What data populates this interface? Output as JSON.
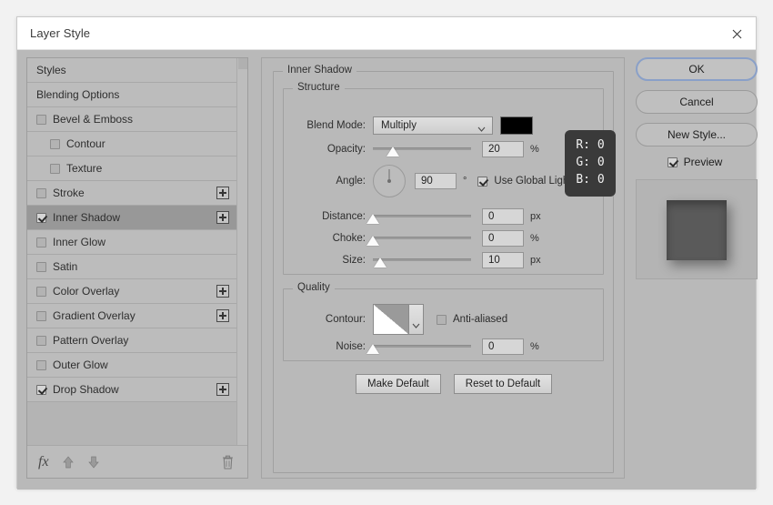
{
  "window": {
    "title": "Layer Style",
    "close_icon": "close-icon"
  },
  "styles_panel": {
    "items": [
      {
        "label": "Styles",
        "checkbox": false,
        "checked": false,
        "indent": false,
        "plus": false,
        "selected": false
      },
      {
        "label": "Blending Options",
        "checkbox": false,
        "checked": false,
        "indent": false,
        "plus": false,
        "selected": false
      },
      {
        "label": "Bevel & Emboss",
        "checkbox": true,
        "checked": false,
        "indent": false,
        "plus": false,
        "selected": false
      },
      {
        "label": "Contour",
        "checkbox": true,
        "checked": false,
        "indent": true,
        "plus": false,
        "selected": false
      },
      {
        "label": "Texture",
        "checkbox": true,
        "checked": false,
        "indent": true,
        "plus": false,
        "selected": false
      },
      {
        "label": "Stroke",
        "checkbox": true,
        "checked": false,
        "indent": false,
        "plus": true,
        "selected": false
      },
      {
        "label": "Inner Shadow",
        "checkbox": true,
        "checked": true,
        "indent": false,
        "plus": true,
        "selected": true
      },
      {
        "label": "Inner Glow",
        "checkbox": true,
        "checked": false,
        "indent": false,
        "plus": false,
        "selected": false
      },
      {
        "label": "Satin",
        "checkbox": true,
        "checked": false,
        "indent": false,
        "plus": false,
        "selected": false
      },
      {
        "label": "Color Overlay",
        "checkbox": true,
        "checked": false,
        "indent": false,
        "plus": true,
        "selected": false
      },
      {
        "label": "Gradient Overlay",
        "checkbox": true,
        "checked": false,
        "indent": false,
        "plus": true,
        "selected": false
      },
      {
        "label": "Pattern Overlay",
        "checkbox": true,
        "checked": false,
        "indent": false,
        "plus": false,
        "selected": false
      },
      {
        "label": "Outer Glow",
        "checkbox": true,
        "checked": false,
        "indent": false,
        "plus": false,
        "selected": false
      },
      {
        "label": "Drop Shadow",
        "checkbox": true,
        "checked": true,
        "indent": false,
        "plus": true,
        "selected": false
      }
    ],
    "footer": {
      "fx_label": "fx",
      "move_up_icon": "arrow-up-icon",
      "move_down_icon": "arrow-down-icon",
      "delete_icon": "trash-icon"
    }
  },
  "effect": {
    "title": "Inner Shadow",
    "structure": {
      "legend": "Structure",
      "blend_mode": {
        "label": "Blend Mode:",
        "value": "Multiply",
        "color": "#000000"
      },
      "opacity": {
        "label": "Opacity:",
        "value": "20",
        "unit": "%",
        "percent": 20
      },
      "angle": {
        "label": "Angle:",
        "value": "90",
        "unit": "°",
        "use_global_light": {
          "label": "Use Global Light",
          "checked": true
        }
      },
      "distance": {
        "label": "Distance:",
        "value": "0",
        "unit": "px",
        "percent": 0
      },
      "choke": {
        "label": "Choke:",
        "value": "0",
        "unit": "%",
        "percent": 0
      },
      "size": {
        "label": "Size:",
        "value": "10",
        "unit": "px",
        "percent": 7
      }
    },
    "quality": {
      "legend": "Quality",
      "contour": {
        "label": "Contour:",
        "anti_aliased": {
          "label": "Anti-aliased",
          "checked": false
        }
      },
      "noise": {
        "label": "Noise:",
        "value": "0",
        "unit": "%",
        "percent": 0
      }
    },
    "actions": {
      "make_default": "Make Default",
      "reset_to_default": "Reset to Default"
    }
  },
  "color_tooltip": {
    "r": "R: 0",
    "g": "G: 0",
    "b": "B: 0"
  },
  "right_panel": {
    "ok": "OK",
    "cancel": "Cancel",
    "new_style": "New Style...",
    "preview": {
      "label": "Preview",
      "checked": true
    }
  }
}
